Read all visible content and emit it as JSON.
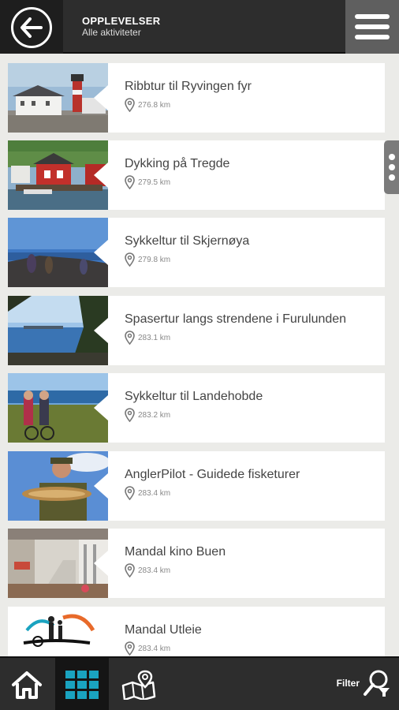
{
  "header": {
    "title": "OPPLEVELSER",
    "subtitle": "Alle aktiviteter"
  },
  "icons": {
    "back": "arrow-left-icon",
    "menu": "hamburger-menu-icon",
    "home": "home-icon",
    "grid": "grid-icon",
    "map": "map-icon",
    "filter": "filter-icon",
    "location": "location-pin-icon"
  },
  "items": [
    {
      "title": "Ribbtur til Ryvingen fyr",
      "distance": "276.8 km"
    },
    {
      "title": "Dykking på Tregde",
      "distance": "279.5 km"
    },
    {
      "title": "Sykkeltur til Skjernøya",
      "distance": "279.8 km"
    },
    {
      "title": "Spasertur langs strendene i Furulunden",
      "distance": "283.1 km"
    },
    {
      "title": "Sykkeltur til Landehobde",
      "distance": "283.2 km"
    },
    {
      "title": "AnglerPilot - Guidede fisketurer",
      "distance": "283.4 km"
    },
    {
      "title": "Mandal kino Buen",
      "distance": "283.4 km"
    },
    {
      "title": "Mandal Utleie",
      "distance": "283.4 km"
    }
  ],
  "bottom_nav": {
    "filter_label": "Filter"
  },
  "colors": {
    "header_bg": "#2d2d2d",
    "accent": "#1aa3c0",
    "list_bg": "#ebebe8"
  }
}
